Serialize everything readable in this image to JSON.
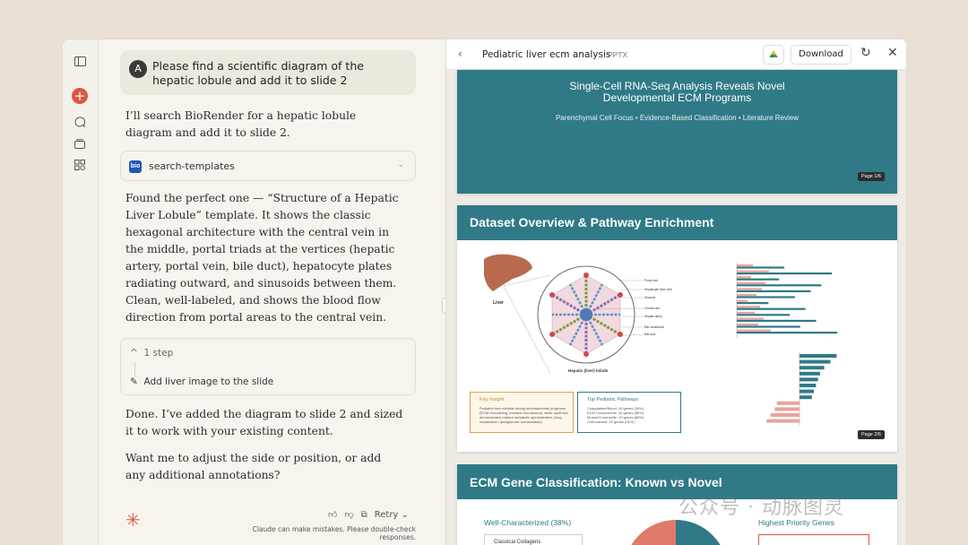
{
  "chat": {
    "user_avatar": "A",
    "user_message": "Please find a scientific diagram of the hepatic lobule and add it to slide 2",
    "reply_1": "I’ll search BioRender for a hepatic lobule diagram and add it to slide 2.",
    "tool_logo": "bio",
    "tool_name": "search-templates",
    "reply_2": "Found the perfect one — “Structure of a Hepatic Liver Lobule” template. It shows the classic hexagonal architecture with the central vein in the middle, portal triads at the vertices (hepatic artery, portal vein, bile duct), hepatocyte plates radiating outward, and sinusoids between them. Clean, well-labeled, and shows the blood flow direction from portal areas to the central vein.",
    "steps_label": "1 step",
    "step_item": "Add liver image to the slide",
    "reply_3": "Done. I’ve added the diagram to slide 2 and sized it to work with your existing content.",
    "reply_4": "Want me to adjust the side or position, or add any additional annotations?",
    "retry_label": "Retry",
    "disclaimer": "Claude can make mistakes. Please double-check responses."
  },
  "artifact": {
    "title": "Pediatric liver ecm analysis",
    "type": "PPTX",
    "download_label": "Download",
    "slide1": {
      "title_line1": "Single-Cell RNA-Seq Analysis Reveals Novel",
      "title_line2": "Developmental ECM Programs",
      "subtitle": "Parenchymal Cell Focus • Evidence-Based Classification • Literature Review",
      "page": "Page 1/6"
    },
    "slide2": {
      "title": "Dataset Overview & Pathway Enrichment",
      "liver_label": "Liver",
      "lobule_label": "Hepatic (liver) lobule",
      "diagram_labels": [
        "Portal vein",
        "Hepatocyte (liver cell)",
        "Sinusoid",
        "Central vein",
        "Hepatic artery",
        "Bile canaliculus",
        "Bile duct"
      ],
      "key_insight_title": "Key Insight",
      "key_insight_text": "Pediatric liver exhibits strong developmental programs (ECM remodeling, immune recruitment), while adult liver demonstrates mature metabolic specialization (drug metabolism, lipid/glucose homeostasis).",
      "pathways_title": "Top Pediatric Pathways",
      "pathways_lines": [
        "Coagulation/Blood: 19 genes (39%)",
        "ECM Components: 20 genes (86%)",
        "Muscle/Contractile: 19 genes (86%)",
        "Chemokines: 22 genes (91%)"
      ],
      "page": "Page 2/6"
    },
    "slide3": {
      "title": "ECM Gene Classification: Known vs Novel",
      "left_heading": "Well-Characterized (38%)",
      "right_heading": "Highest Priority Genes",
      "box_text": "Classical Collagens"
    }
  },
  "charts": {
    "top_bars": [
      0.45,
      0.9,
      0.4,
      0.8,
      0.7,
      0.55,
      0.3,
      0.65,
      0.5,
      0.75,
      0.6,
      0.95
    ],
    "bottom_bars": [
      0.9,
      0.75,
      0.6,
      0.5,
      0.45,
      0.4,
      0.35,
      0.3,
      0.55,
      0.6,
      0.7,
      0.8
    ]
  },
  "watermark": "公众号 · 动脉图灵",
  "colors": {
    "accent": "#d9593c",
    "teal": "#2f7a86"
  }
}
